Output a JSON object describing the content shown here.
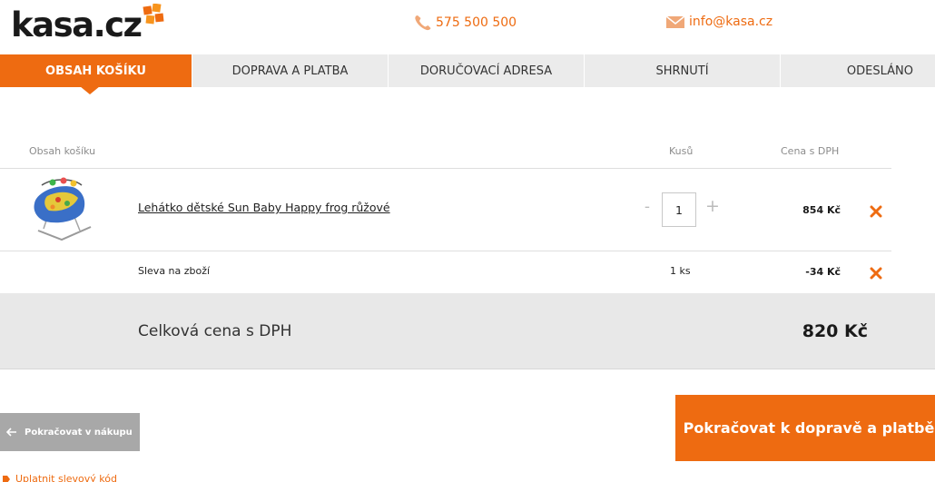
{
  "header": {
    "logo_text": "kasa.cz",
    "phone": "575 500 500",
    "email": "info@kasa.cz",
    "accent_color": "#ee6b11"
  },
  "steps": [
    {
      "label": "OBSAH KOŠÍKU",
      "active": true
    },
    {
      "label": "DOPRAVA A PLATBA",
      "active": false
    },
    {
      "label": "DORUČOVACÍ ADRESA",
      "active": false
    },
    {
      "label": "SHRNUTÍ",
      "active": false
    },
    {
      "label": "ODESLÁNO",
      "active": false
    }
  ],
  "cart": {
    "headers": {
      "content": "Obsah košíku",
      "qty": "Kusů",
      "price": "Cena s DPH"
    },
    "items": [
      {
        "name": "Lehátko dětské Sun Baby Happy frog růžové",
        "qty": "1",
        "qty_minus": "-",
        "qty_plus": "+",
        "price": "854 Kč",
        "image_icon": "baby-bouncer-image"
      }
    ],
    "discount": {
      "name": "Sleva na zboží",
      "qty": "1 ks",
      "price": "-34 Kč"
    },
    "total": {
      "label": "Celková cena s DPH",
      "value": "820 Kč"
    }
  },
  "actions": {
    "back_label": "Pokračovat v nákupu",
    "next_label": "Pokračovat k dopravě a platbě",
    "coupon_label": "Uplatnit slevový kód"
  }
}
